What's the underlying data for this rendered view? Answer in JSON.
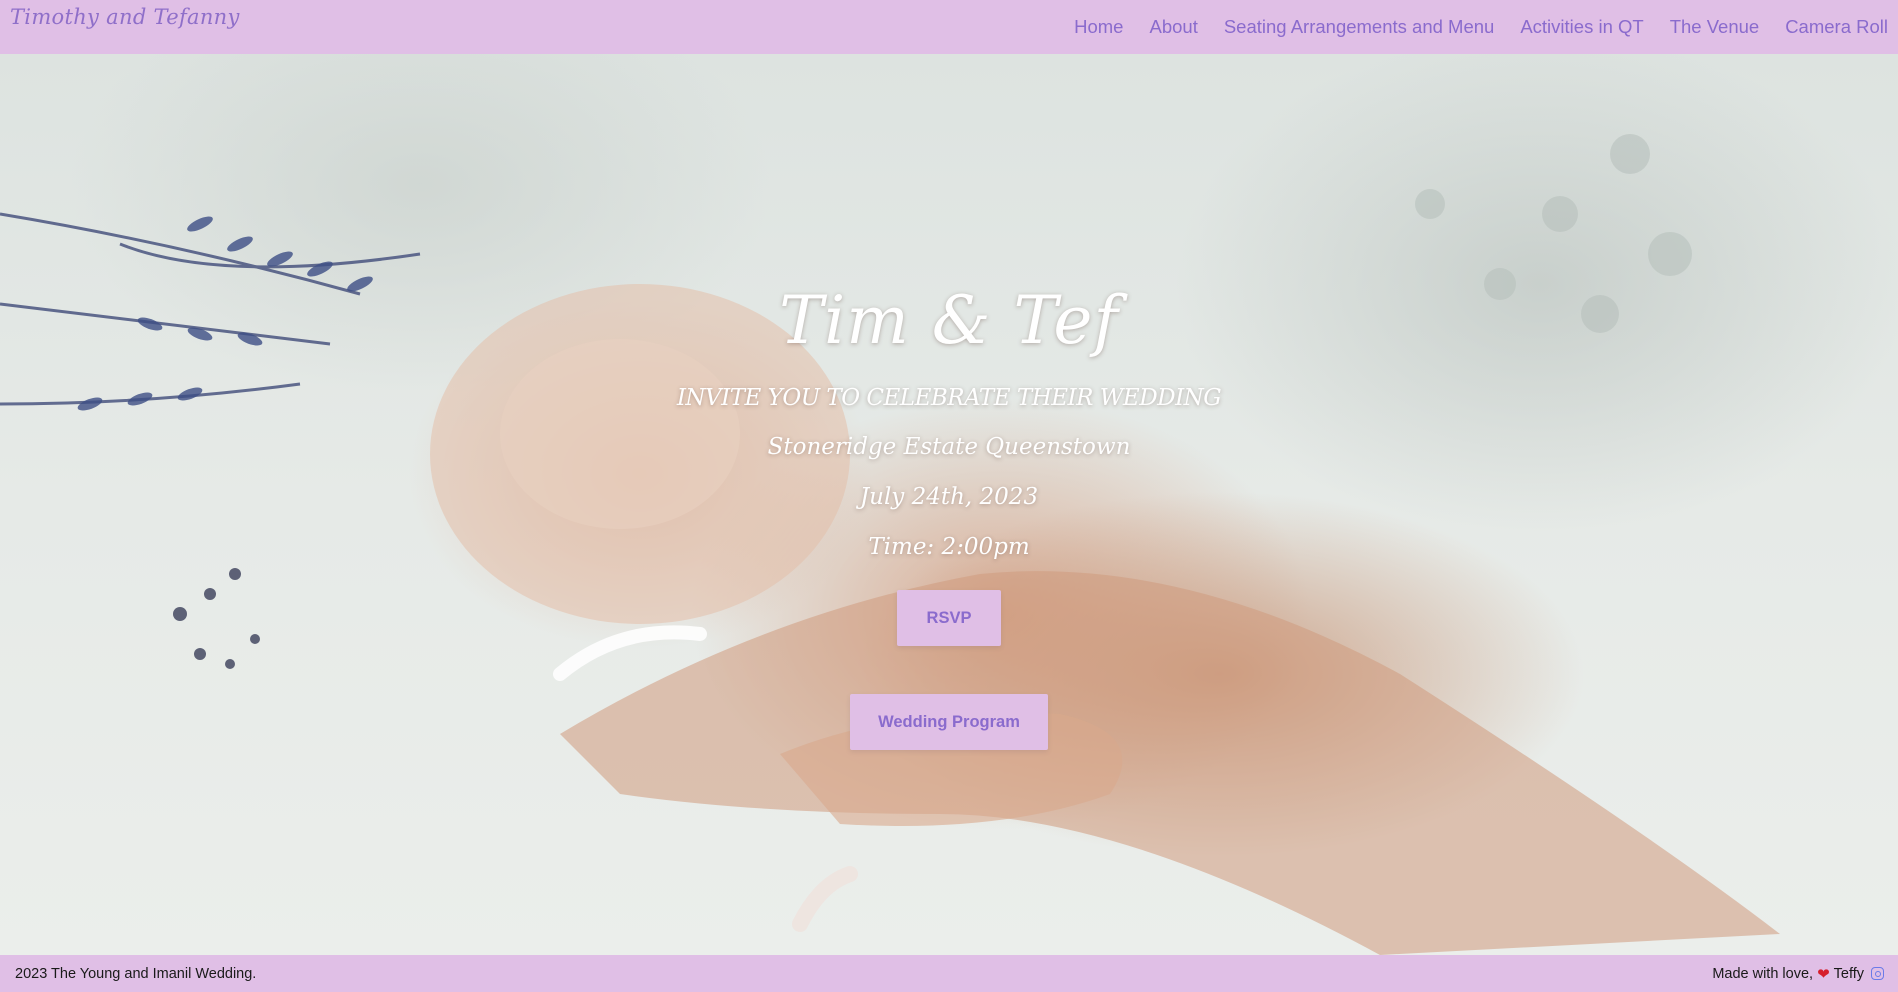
{
  "header": {
    "brand": "Timothy and Tefanny",
    "nav": [
      "Home",
      "About",
      "Seating Arrangements and Menu",
      "Activities in QT",
      "The Venue",
      "Camera Roll"
    ]
  },
  "hero": {
    "title": "Tim & Tef",
    "subtitle": "INVITE YOU TO CELEBRATE THEIR WEDDING",
    "venue": "Stoneridge Estate Queenstown",
    "date": "July 24th, 2023",
    "time": "Time: 2:00pm",
    "rsvp_label": "RSVP",
    "program_label": "Wedding Program"
  },
  "footer": {
    "copyright": "2023 The Young and Imanil Wedding.",
    "made_with": "Made with love,",
    "heart": "❤",
    "author": "Teffy"
  },
  "colors": {
    "bar_background": "#e0bfe6",
    "accent_text": "#8a6bcd",
    "heart": "#d61f2c"
  },
  "icons": [
    "heart-icon",
    "instagram-icon"
  ]
}
